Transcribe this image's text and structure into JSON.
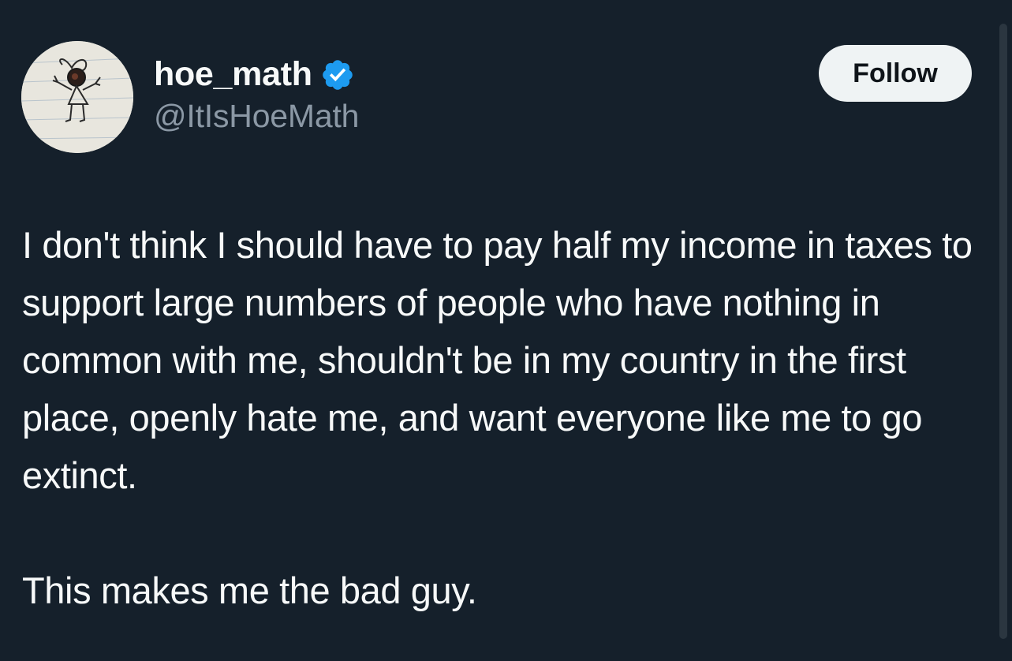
{
  "author": {
    "display_name": "hoe_math",
    "handle": "@ItIsHoeMath",
    "verified": true,
    "avatar_icon": "stick-figure-drawing-avatar"
  },
  "actions": {
    "follow_label": "Follow"
  },
  "tweet": {
    "paragraphs": [
      "I don't think I should have to pay half my income in taxes to support large numbers of people who have nothing in common with me, shouldn't be in my country in the first place, openly hate me, and want everyone like me to go extinct.",
      "This makes me the bad guy."
    ]
  },
  "colors": {
    "background": "#15202b",
    "primary_text": "#f7f9f9",
    "secondary_text": "#8b98a5",
    "verified_blue": "#1d9bf0",
    "button_bg": "#eff3f4",
    "button_text": "#0f1419"
  }
}
